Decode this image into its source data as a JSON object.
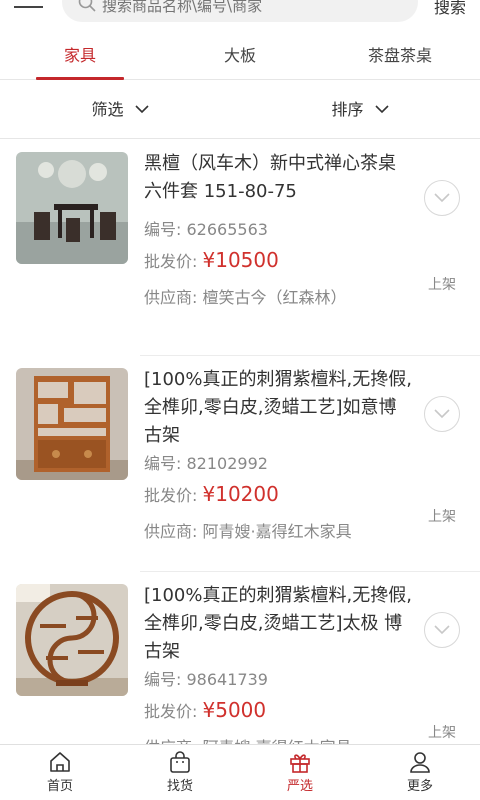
{
  "search": {
    "placeholder": "搜索商品名称\\编号\\商家",
    "button_label": "搜索"
  },
  "tabs": [
    {
      "label": "家具",
      "active": true
    },
    {
      "label": "大板",
      "active": false
    },
    {
      "label": "茶盘茶桌",
      "active": false
    }
  ],
  "filters": [
    {
      "label": "筛选"
    },
    {
      "label": "排序"
    }
  ],
  "labels": {
    "code": "编号:",
    "wholesale_price": "批发价:",
    "supplier": "供应商:"
  },
  "products": [
    {
      "title": "黑檀（风车木）新中式禅心茶桌 六件套 151-80-75",
      "code": "62665563",
      "price": "¥10500",
      "supplier": "檀笑古今（红森林）",
      "status": "上架"
    },
    {
      "title": "[100%真正的刺猬紫檀料,无搀假,全榫卯,零白皮,烫蜡工艺]如意博古架",
      "code": "82102992",
      "price": "¥10200",
      "supplier": "阿青嫂·嘉得红木家具",
      "status": "上架"
    },
    {
      "title": "[100%真正的刺猬紫檀料,无搀假,全榫卯,零白皮,烫蜡工艺]太极 博古架",
      "code": "98641739",
      "price": "¥5000",
      "supplier": "阿青嫂·嘉得红木家具",
      "status": "上架"
    }
  ],
  "bottom_nav": [
    {
      "label": "首页",
      "icon": "home-icon",
      "active": false
    },
    {
      "label": "找货",
      "icon": "bag-icon",
      "active": false
    },
    {
      "label": "严选",
      "icon": "gift-icon",
      "active": true
    },
    {
      "label": "更多",
      "icon": "user-icon",
      "active": false
    }
  ],
  "colors": {
    "accent": "#c4282b",
    "price": "#d0312d"
  }
}
